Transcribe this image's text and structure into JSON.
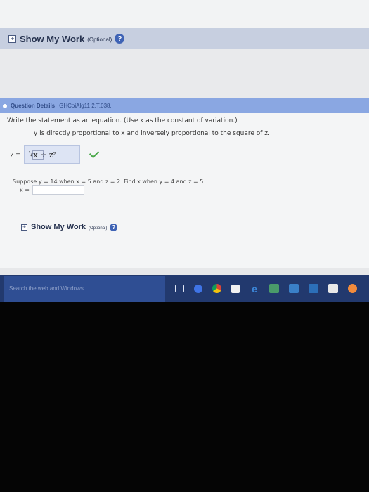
{
  "show_my_work": {
    "label": "Show My Work",
    "optional": "(Optional)",
    "help": "?"
  },
  "question": {
    "header_label": "Question Details",
    "question_id": "GHCoiAlg11 2.T.038.",
    "instruction": "Write the statement as an equation. (Use k as the constant of variation.)",
    "statement": "y is directly proportional to x and inversely proportional to the square of z.",
    "y_label": "y =",
    "answer_value": "kx ÷ z²",
    "suppose_text": "Suppose  y = 14  when  x = 5  and  z = 2.  Find x when  y = 4  and  z = 5.",
    "x_label": "x =",
    "x_value": ""
  },
  "show_my_work_2": {
    "label": "Show My Work",
    "optional": "(Optional)",
    "help": "?"
  },
  "taskbar": {
    "search_placeholder": "Search the web and Windows"
  },
  "colors": {
    "show_my_work_bar": "#c7cfe0",
    "question_header_bar": "#8aa7e2",
    "taskbar": "#22396e",
    "correct_check": "#4aa84a"
  }
}
